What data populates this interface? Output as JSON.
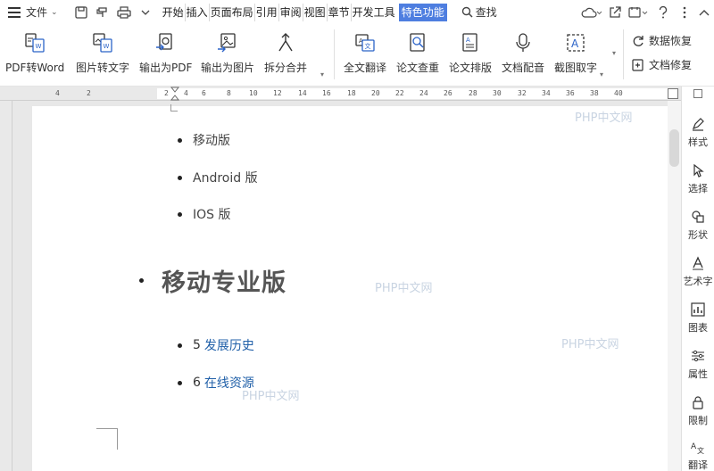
{
  "menubar": {
    "file_label": "文件",
    "tabs": [
      "开始",
      "插入",
      "页面布局",
      "引用",
      "审阅",
      "视图",
      "章节",
      "开发工具",
      "特色功能"
    ],
    "active_tab": "特色功能",
    "search_label": "查找"
  },
  "ribbon": {
    "buttons": [
      {
        "label": "PDF转Word"
      },
      {
        "label": "图片转文字"
      },
      {
        "label": "输出为PDF"
      },
      {
        "label": "输出为图片"
      },
      {
        "label": "拆分合并"
      },
      {
        "label": "全文翻译"
      },
      {
        "label": "论文查重"
      },
      {
        "label": "论文排版"
      },
      {
        "label": "文档配音"
      },
      {
        "label": "截图取字"
      }
    ],
    "small": [
      {
        "label": "数据恢复"
      },
      {
        "label": "文档修复"
      }
    ]
  },
  "ruler": {
    "ticks": [
      "4",
      "2",
      "2",
      "4",
      "6",
      "8",
      "10",
      "12",
      "14",
      "16",
      "18",
      "20",
      "22",
      "24",
      "26",
      "28",
      "30",
      "32",
      "34",
      "36",
      "38",
      "40"
    ]
  },
  "document": {
    "items": [
      {
        "text": "移动版"
      },
      {
        "text": "Android 版"
      },
      {
        "text": "IOS 版"
      }
    ],
    "heading": "移动专业版",
    "links": [
      {
        "num": "5",
        "text": "发展历史"
      },
      {
        "num": "6",
        "text": "在线资源"
      }
    ],
    "watermark": "PHP中文网"
  },
  "sidebar": {
    "items": [
      "样式",
      "选择",
      "形状",
      "艺术字",
      "图表",
      "属性",
      "限制",
      "翻译"
    ]
  }
}
